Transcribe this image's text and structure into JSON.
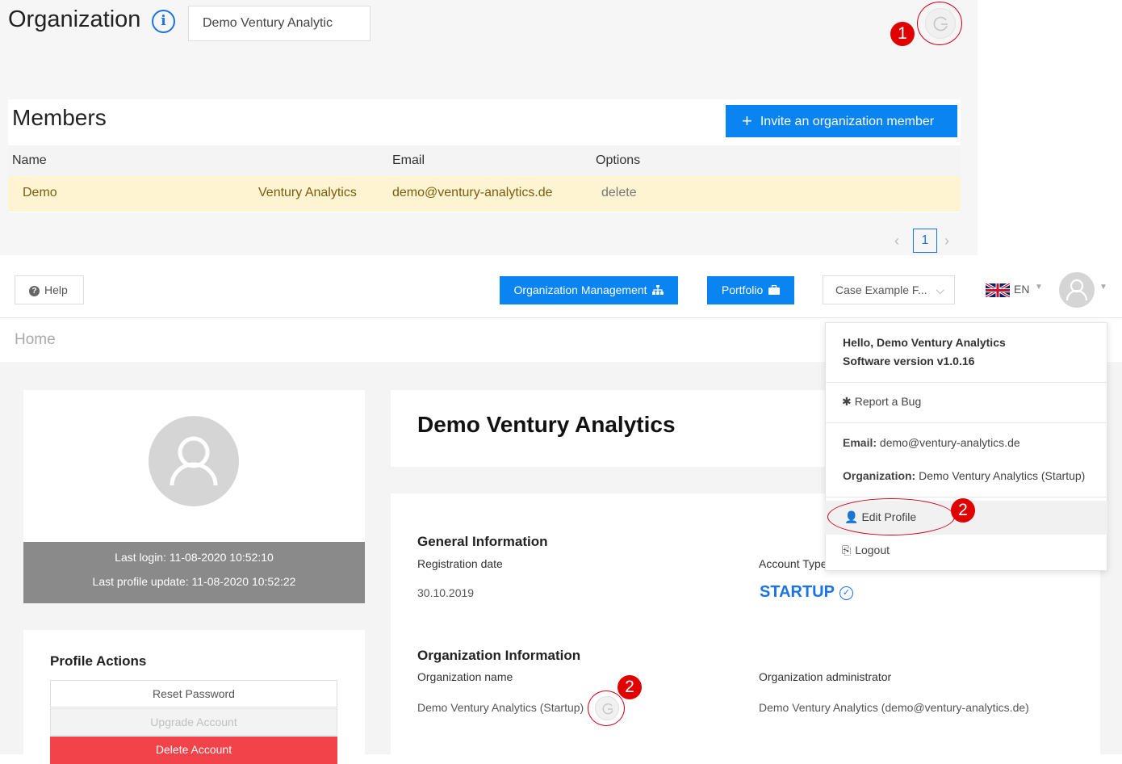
{
  "top": {
    "title": "Organization",
    "info_icon": "i",
    "org_name_value": "Demo Ventury Analytic",
    "badge_1": "1",
    "badge_2": "2"
  },
  "members": {
    "title": "Members",
    "invite_label": "Invite an organization member",
    "columns": [
      "Name",
      "Email",
      "Options"
    ],
    "rows": [
      {
        "first_name": "Demo",
        "last_name": "Ventury Analytics",
        "email": "demo@ventury-analytics.de",
        "option": "delete"
      }
    ],
    "pagination": {
      "prev": "‹",
      "current": "1",
      "next": "›"
    }
  },
  "nav": {
    "help_label": "Help",
    "org_mgmt_label": "Organization Management",
    "portfolio_label": "Portfolio",
    "case_select_value": "Case Example F...",
    "language": "EN"
  },
  "breadcrumb": "Home",
  "profile": {
    "last_login": "Last login: 11-08-2020 10:52:10",
    "last_update": "Last profile update: 11-08-2020 10:52:22",
    "actions_title": "Profile Actions",
    "reset_password": "Reset Password",
    "upgrade_account": "Upgrade Account",
    "delete_account": "Delete Account"
  },
  "org": {
    "name": "Demo Ventury Analytics",
    "general_title": "General Information",
    "registration_label": "Registration date",
    "registration_value": "30.10.2019",
    "account_type_label": "Account Type",
    "account_type_value": "STARTUP",
    "org_info_title": "Organization Information",
    "org_name_label": "Organization name",
    "org_name_value": "Demo Ventury Analytics (Startup)",
    "org_admin_label": "Organization administrator",
    "org_admin_value": "Demo Ventury Analytics (demo@ventury-analytics.de)"
  },
  "dropdown": {
    "hello": "Hello, Demo Ventury Analytics",
    "version": "Software version v1.0.16",
    "report_bug": "Report a Bug",
    "email_label": "Email:",
    "email_value": "demo@ventury-analytics.de",
    "organization_label": "Organization:",
    "organization_value": "Demo Ventury Analytics (Startup)",
    "edit_profile": "Edit Profile",
    "logout": "Logout"
  },
  "colors": {
    "primary": "#0a84f0",
    "row_highlight": "#fff4d1",
    "annotation_red": "#e00000",
    "danger": "#f2434a"
  }
}
